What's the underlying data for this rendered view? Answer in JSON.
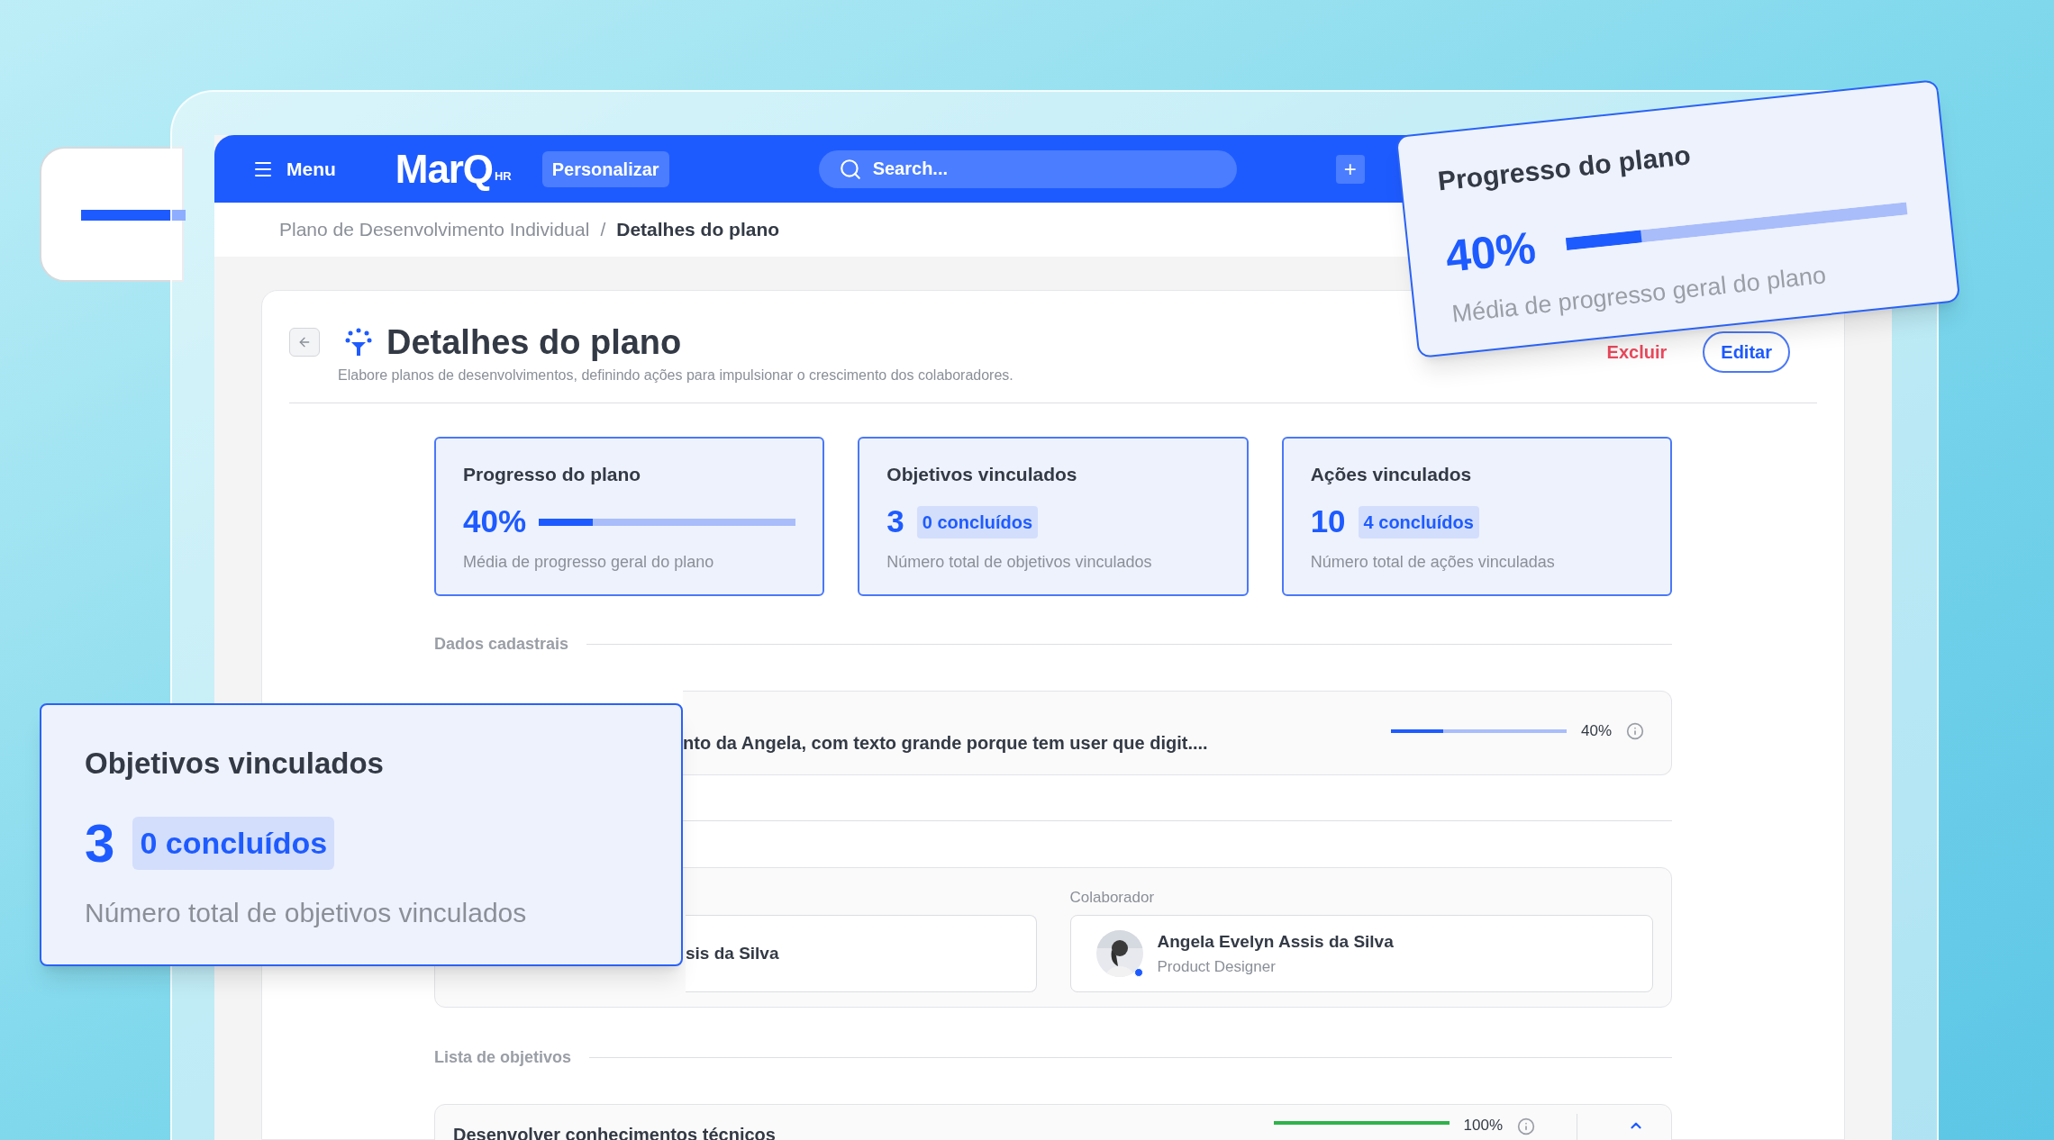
{
  "header": {
    "menu_label": "Menu",
    "logo": "MarQ",
    "logo_suffix": "HR",
    "customize_button": "Personalizar",
    "search": {
      "placeholder": "Search..."
    },
    "add_button": "+"
  },
  "breadcrumb": [
    {
      "label": "Plano de Desenvolvimento Individual",
      "current": false
    },
    {
      "label": "Detalhes do plano",
      "current": true
    }
  ],
  "breadcrumb_separator": "/",
  "page": {
    "title": "Detalhes do plano",
    "subtitle": "Elabore planos de desenvolvimentos, definindo ações para impulsionar o crescimento dos colaboradores.",
    "actions": [
      {
        "label": "Excluir",
        "kind": "danger"
      },
      {
        "label": "Editar",
        "kind": "outline"
      }
    ]
  },
  "stats": [
    {
      "kind": "progress",
      "title": "Progresso do plano",
      "value": "40%",
      "level": 0.21,
      "description": "Média de progresso geral do plano"
    },
    {
      "kind": "count",
      "title": "Objetivos vinculados",
      "value": "3",
      "badge": "0 concluídos",
      "description": "Número total de objetivos vinculados"
    },
    {
      "kind": "count",
      "title": "Ações vinculados",
      "value": "10",
      "badge": "4 concluídos",
      "description": "Número total de ações vinculadas"
    }
  ],
  "registration": {
    "section_label": "Dados cadastrais",
    "objective": {
      "text": "nto da Angela, com texto grande porque tem user que digit....",
      "level": 0.3,
      "reading": "40%"
    },
    "people": [
      {
        "name": "sis da Silva"
      },
      {
        "label": "Colaborador",
        "name": "Angela Evelyn Assis da Silva",
        "role": "Product Designer",
        "online": true
      }
    ]
  },
  "objectives_list": {
    "section_label": "Lista de objetivos",
    "items": [
      {
        "title": "Desenvolver conhecimentos técnicos",
        "level": 1,
        "reading": "100%"
      }
    ]
  },
  "overlays": {
    "progress_card": {
      "title": "Progresso do plano",
      "value": "40%",
      "level": 0.22,
      "description": "Média de progresso geral do plano"
    },
    "objectives_card": {
      "title": "Objetivos vinculados",
      "value": "3",
      "badge": "0 concluídos",
      "description": "Número total de objetivos vinculados"
    }
  }
}
